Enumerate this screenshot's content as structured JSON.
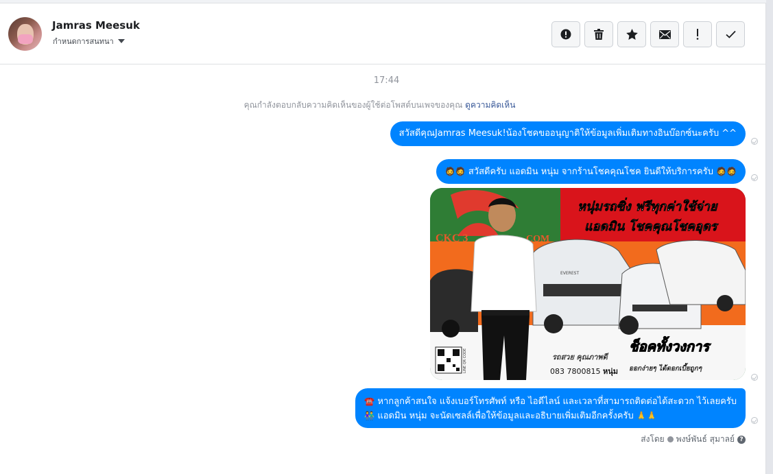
{
  "header": {
    "name": "Jamras Meesuk",
    "assign_label": "กำหนดการสนทนา"
  },
  "toolbar": {
    "items": [
      {
        "icon": "alert-circle-icon"
      },
      {
        "icon": "trash-icon"
      },
      {
        "icon": "star-icon"
      },
      {
        "icon": "envelope-icon"
      },
      {
        "icon": "exclamation-icon"
      },
      {
        "icon": "check-icon"
      }
    ]
  },
  "thread": {
    "time": "17:44",
    "notice_text": "คุณกำลังตอบกลับความคิดเห็นของผู้ใช้ต่อโพสต์บนเพจของคุณ",
    "notice_link": "ดูความคิดเห็น",
    "messages": [
      {
        "text": "สวัสดีคุณJamras Meesuk!น้องโชคขออนุญาติให้ข้อมูลเพิ่มเติมทางอินบ๊อกซ์นะครับ ^^"
      },
      {
        "text": "สวัสดีครับ แอดมิน หนุ่ม จากร้านโชคคุณโชค ยินดีให้บริการครับ"
      },
      {
        "line1": "หากลูกค้าสนใจ แจ้งเบอร์โทรศัพท์ หรือ ไอดีไลน์ และเวลาที่สามารถติดต่อได้สะดวก ไว้เลยครับ",
        "line2": "แอดมิน หนุ่ม จะนัดเซลล์เพื่อให้ข้อมูลและอธิบายเพิ่มเติมอีกครั้งครับ"
      }
    ],
    "sent_by_label": "ส่งโดย",
    "sent_by_name": "พงษ์พันธ์ สุมาลย์"
  },
  "photo": {
    "headline1": "หนุ่มรถซิ่ง ฟรีทุกค่าใช้จ่าย",
    "headline2": "แอดมิน โชคคุณโชคอุดร",
    "logo_text": "CKC 3",
    "logo_suffix": "COM",
    "slogan": "ช็อคทั้งวงการ",
    "tagline": "รถสวย คุณภาพดี",
    "phone": "083 7800815",
    "phone_name": "หนุ่ม",
    "tagline2": "ออกง่ายๆ ได้ดอกเบี้ยถูกๆ",
    "car_badge": "EVEREST",
    "qr_caption": "LINE QR CODE"
  },
  "colors": {
    "bubble": "#0084ff",
    "banner_red": "#d9141b",
    "banner_orange": "#f26b1d",
    "banner_green": "#1f6b2f"
  }
}
